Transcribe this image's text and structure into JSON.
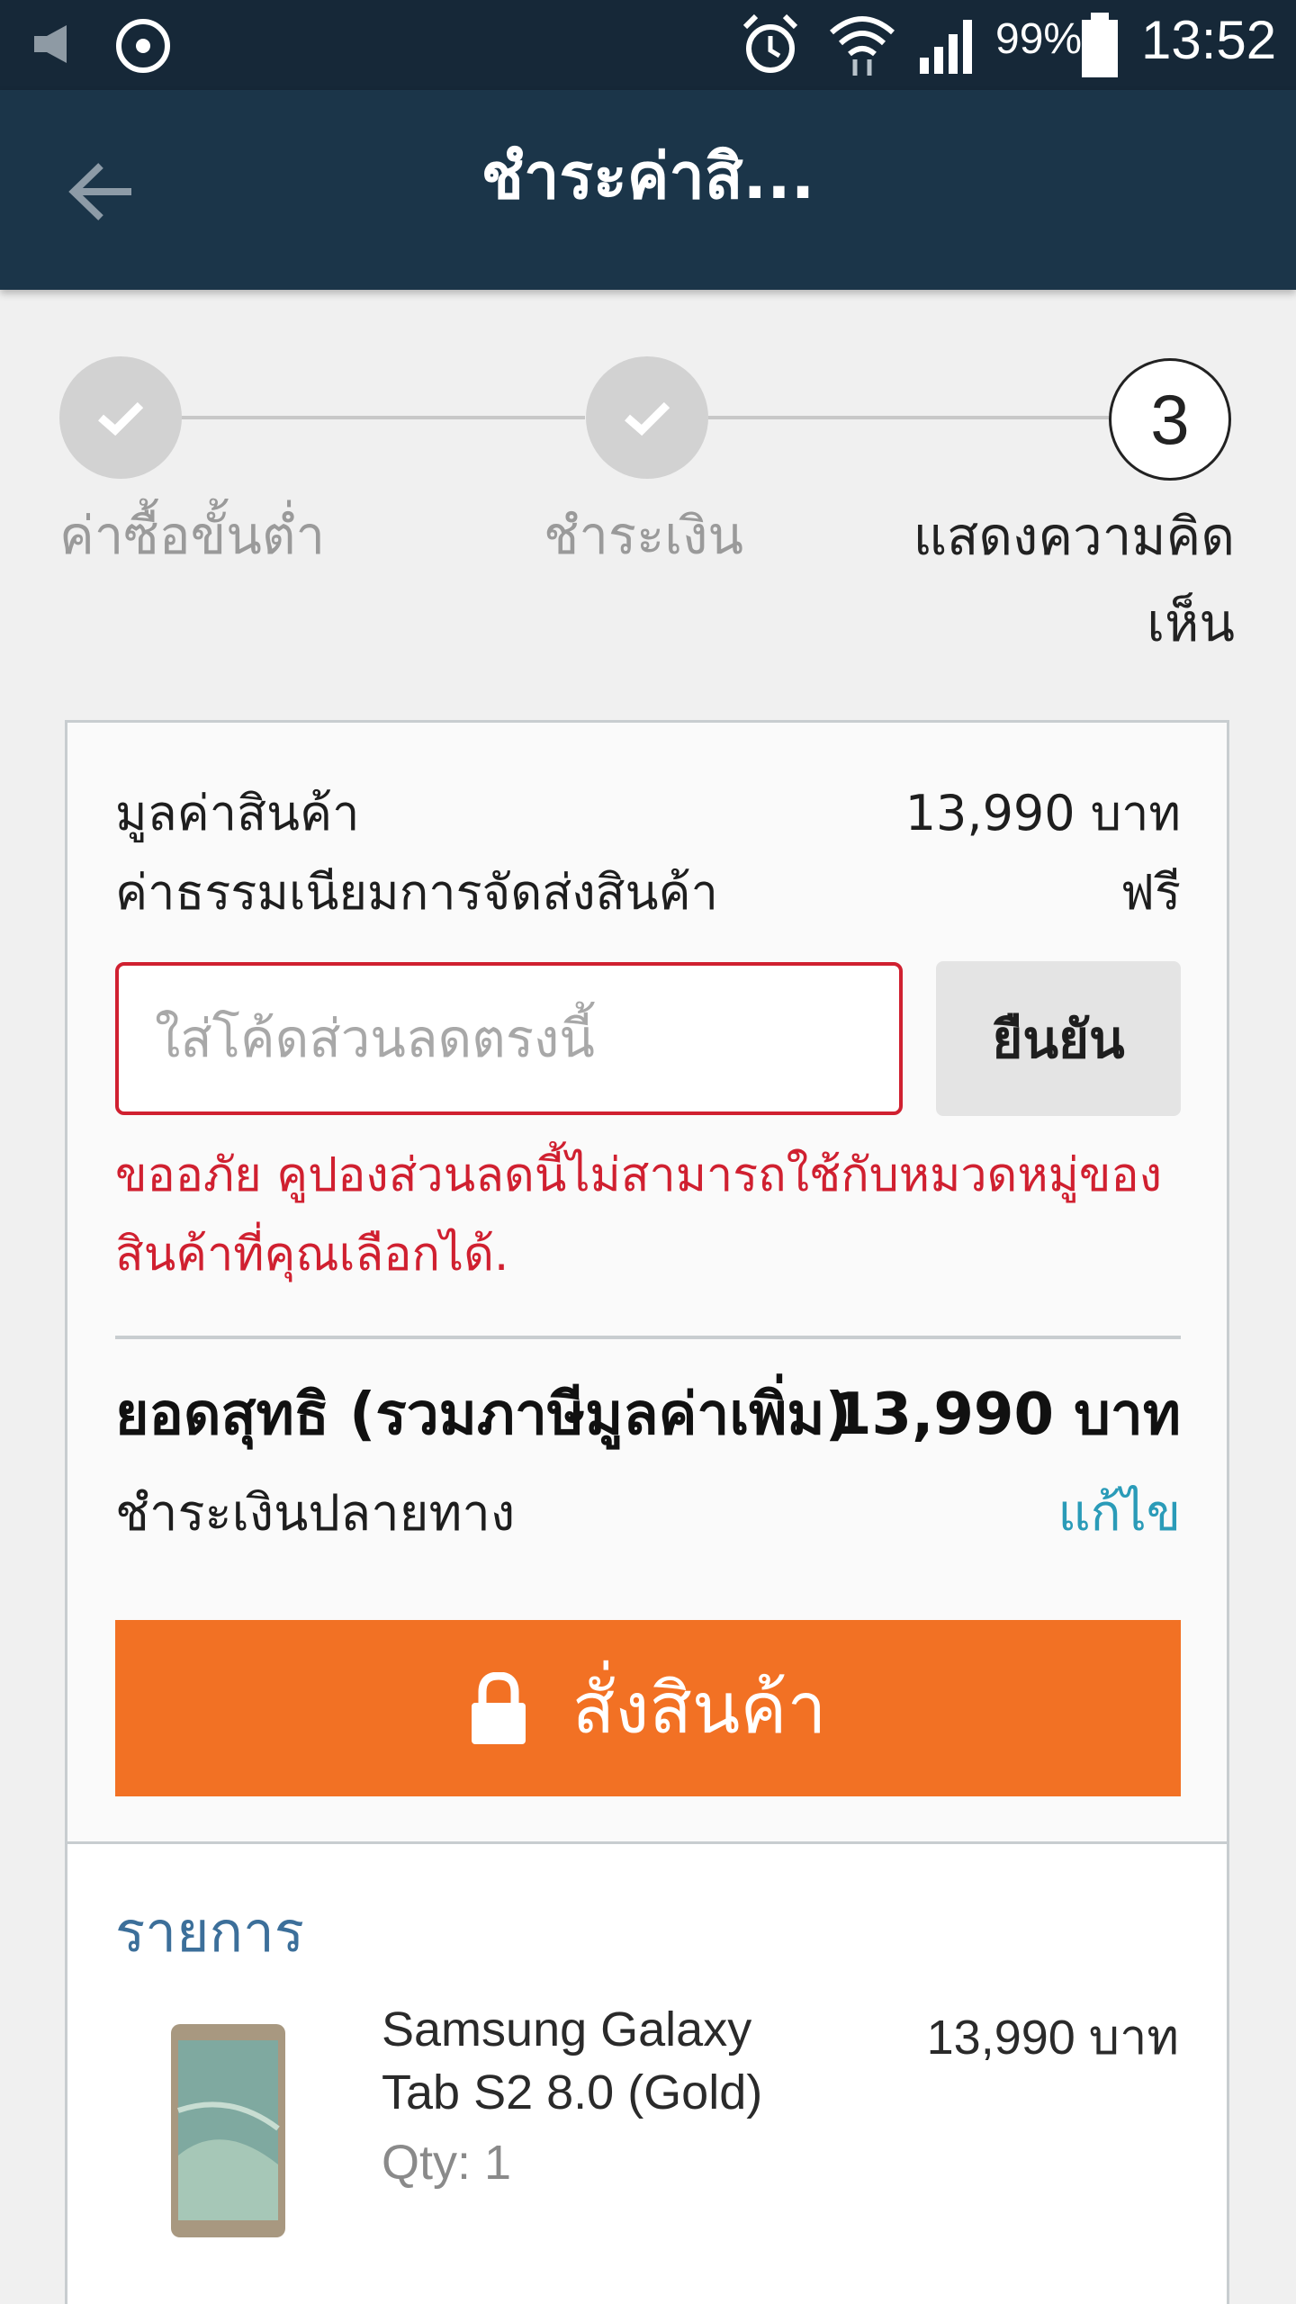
{
  "status_bar": {
    "battery_percent": "99%",
    "time": "13:52",
    "icons": [
      "volume-muted-icon",
      "sync-icon",
      "alarm-icon",
      "wifi-icon",
      "signal-icon",
      "battery-icon"
    ]
  },
  "app_bar": {
    "title": "ชำระค่าสิ...",
    "back_icon": "arrow-left-icon"
  },
  "stepper": {
    "steps": [
      {
        "label": "ค่าซื้อขั้นต่ำ",
        "state": "done"
      },
      {
        "label": "ชำระเงิน",
        "state": "done"
      },
      {
        "label_line1": "แสดงความคิด",
        "label_line2": "เห็น",
        "number": "3",
        "state": "active"
      }
    ]
  },
  "summary": {
    "subtotal_label": "มูลค่าสินค้า",
    "subtotal_value": "13,990 บาท",
    "shipping_label": "ค่าธรรมเนียมการจัดส่งสินค้า",
    "shipping_value": "ฟรี",
    "coupon_placeholder": "ใส่โค้ดส่วนลดตรงนี้",
    "coupon_value": "",
    "confirm_label": "ยืนยัน",
    "error_message": "ขออภัย คูปองส่วนลดนี้ไม่สามารถใช้กับหมวดหมู่ของสินค้าที่คุณเลือกได้.",
    "total_label": "ยอดสุทธิ (รวมภาษีมูลค่าเพิ่ม)",
    "total_value": "13,990 บาท",
    "payment_method": "ชำระเงินปลายทาง",
    "edit_label": "แก้ไข",
    "order_label": "สั่งสินค้า"
  },
  "items": {
    "heading": "รายการ",
    "list": [
      {
        "name_line1": "Samsung Galaxy",
        "name_line2": "Tab S2 8.0 (Gold)",
        "qty": "Qty: 1",
        "price": "13,990 บาท"
      }
    ]
  },
  "colors": {
    "status_bar": "#162838",
    "app_bar": "#1b3549",
    "accent_orange": "#f27124",
    "error_red": "#d02030",
    "link_teal": "#2a9bb8",
    "heading_blue": "#3c6f9a"
  }
}
